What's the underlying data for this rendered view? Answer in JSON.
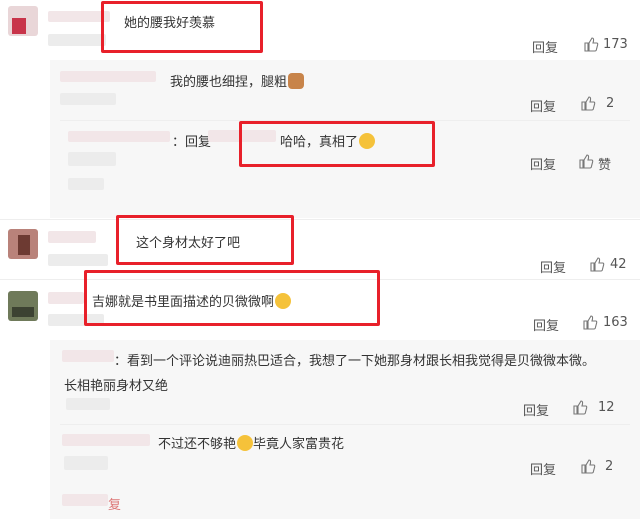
{
  "reply_label": "回复",
  "comments": [
    {
      "text": "她的腰我好羡慕",
      "likes": "173"
    },
    {
      "text": "这个身材太好了吧",
      "likes": "42"
    },
    {
      "text": "吉娜就是书里面描述的贝微微啊",
      "likes": "163"
    }
  ],
  "replies": [
    {
      "text": "我的腰也细捏，腿粗",
      "likes": "2"
    },
    {
      "prefix": "：回复",
      "text": "哈哈，真相了",
      "likes": "赞"
    },
    {
      "text": "：看到一个评论说迪丽热巴适合，我想了一下她那身材跟长相我觉得是贝微微本微。",
      "text2": "长相艳丽身材又绝",
      "likes": "12"
    },
    {
      "text": "不过还不够艳",
      "text_after": "毕竟人家富贵花",
      "likes": "2"
    }
  ],
  "partial_text": "复",
  "icons": {
    "thumb": "thumbs-up-icon",
    "cat": "cat-face-emoji-icon",
    "laugh": "laughing-emoji-icon",
    "grin": "grinning-emoji-icon"
  },
  "colors": {
    "highlight": "#e8202a"
  }
}
